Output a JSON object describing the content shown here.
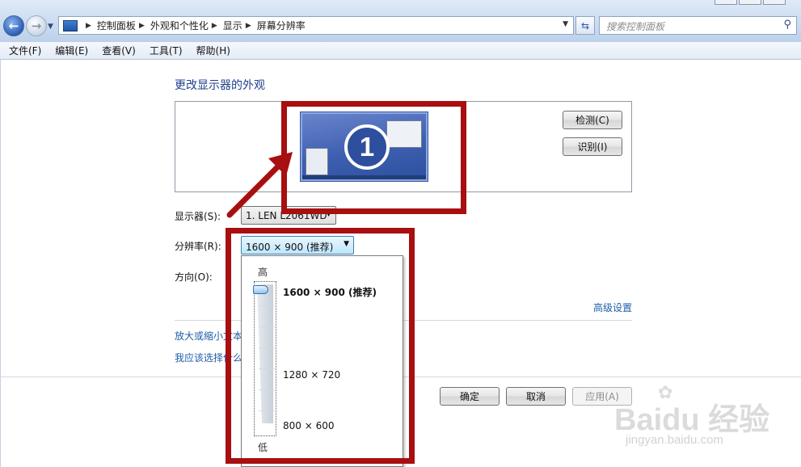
{
  "address_bar": {
    "breadcrumbs": [
      "控制面板",
      "外观和个性化",
      "显示",
      "屏幕分辨率"
    ],
    "search_placeholder": "搜索控制面板"
  },
  "menu": [
    "文件(F)",
    "编辑(E)",
    "查看(V)",
    "工具(T)",
    "帮助(H)"
  ],
  "page": {
    "title": "更改显示器的外观",
    "monitor_number": "1",
    "detect_label": "检测(C)",
    "identify_label": "识别(I)",
    "display_label": "显示器(S):",
    "display_value": "1. LEN L2061WD",
    "resolution_label": "分辨率(R):",
    "resolution_value": "1600 × 900 (推荐)",
    "orientation_label": "方向(O):",
    "advanced_link": "高级设置",
    "link_text_size": "放大或缩小文本",
    "link_choose": "我应该选择什么"
  },
  "slider": {
    "high_label": "高",
    "low_label": "低",
    "options": [
      "1600 × 900 (推荐)",
      "1280 × 720",
      "800 × 600"
    ],
    "selected_index": 0
  },
  "buttons": {
    "ok": "确定",
    "cancel": "取消",
    "apply": "应用(A)"
  },
  "watermark": {
    "brand": "Baidu 经验",
    "url": "jingyan.baidu.com"
  },
  "colors": {
    "highlight": "#a80f10",
    "link": "#1f5ca8",
    "title": "#1f3f8c"
  },
  "icons": {
    "back": "arrow-left",
    "forward": "arrow-right",
    "refresh": "refresh-arrows",
    "search": "magnifier"
  }
}
